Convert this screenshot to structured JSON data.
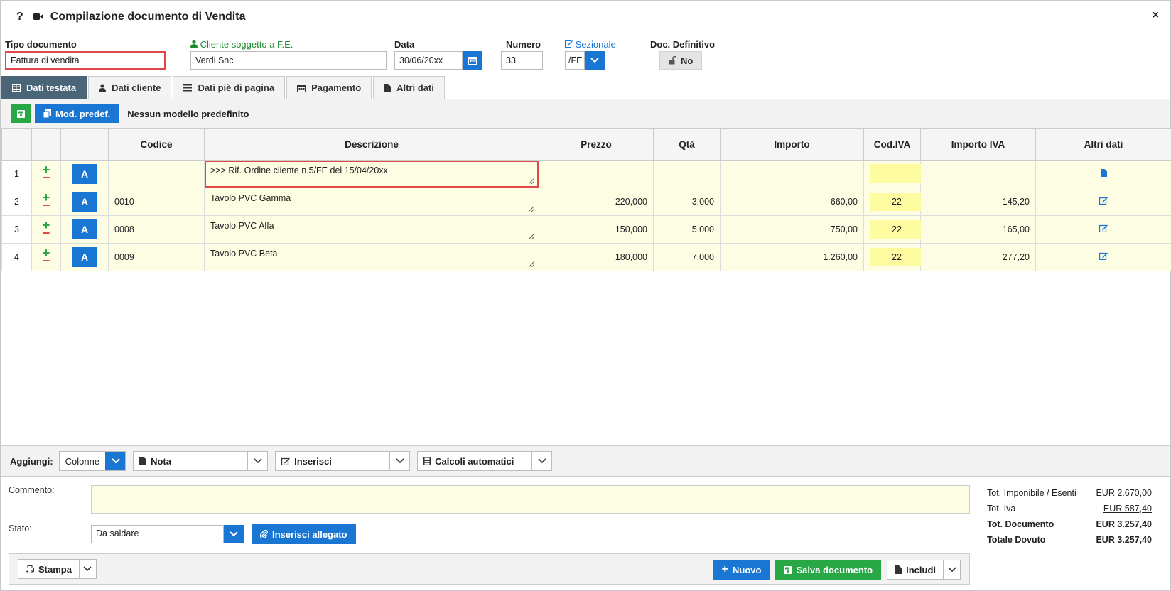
{
  "window": {
    "title": "Compilazione documento di Vendita",
    "help": "?",
    "close": "×"
  },
  "fields": {
    "tipo_documento": {
      "label": "Tipo documento",
      "value": "Fattura di vendita"
    },
    "cliente": {
      "label": "Cliente soggetto a F.E.",
      "value": "Verdi Snc"
    },
    "data": {
      "label": "Data",
      "value": "30/06/20xx"
    },
    "numero": {
      "label": "Numero",
      "value": "33"
    },
    "sezionale": {
      "label": "Sezionale",
      "value": "/FE"
    },
    "doc_definitivo": {
      "label": "Doc. Definitivo",
      "value": "No"
    }
  },
  "tabs": [
    {
      "label": "Dati testata"
    },
    {
      "label": "Dati cliente"
    },
    {
      "label": "Dati piè di pagina"
    },
    {
      "label": "Pagamento"
    },
    {
      "label": "Altri dati"
    }
  ],
  "toolbar": {
    "mod_predef": "Mod. predef.",
    "info": "Nessun modello predefinito"
  },
  "table": {
    "headers": [
      "Codice",
      "Descrizione",
      "Prezzo",
      "Qtà",
      "Importo",
      "Cod.IVA",
      "Importo IVA",
      "Altri dati"
    ],
    "action_label": "A",
    "plus": "+",
    "minus": "−",
    "rows": [
      {
        "n": "1",
        "codice": "",
        "descrizione": ">>> Rif. Ordine cliente n.5/FE del 15/04/20xx",
        "prezzo": "",
        "qta": "",
        "importo": "",
        "cod_iva": "",
        "importo_iva": ""
      },
      {
        "n": "2",
        "codice": "0010",
        "descrizione": "Tavolo PVC Gamma",
        "prezzo": "220,000",
        "qta": "3,000",
        "importo": "660,00",
        "cod_iva": "22",
        "importo_iva": "145,20"
      },
      {
        "n": "3",
        "codice": "0008",
        "descrizione": "Tavolo PVC Alfa",
        "prezzo": "150,000",
        "qta": "5,000",
        "importo": "750,00",
        "cod_iva": "22",
        "importo_iva": "165,00"
      },
      {
        "n": "4",
        "codice": "0009",
        "descrizione": "Tavolo PVC Beta",
        "prezzo": "180,000",
        "qta": "7,000",
        "importo": "1.260,00",
        "cod_iva": "22",
        "importo_iva": "277,20"
      }
    ]
  },
  "addbar": {
    "label": "Aggiungi:",
    "colonne": "Colonne",
    "nota": "Nota",
    "inserisci": "Inserisci",
    "calcoli": "Calcoli automatici"
  },
  "bottom": {
    "commento_label": "Commento:",
    "commento_value": "",
    "stato_label": "Stato:",
    "stato_value": "Da saldare",
    "allegato": "Inserisci allegato",
    "totals": [
      {
        "label": "Tot. Imponibile / Esenti",
        "value": "EUR 2.670,00"
      },
      {
        "label": "Tot. Iva",
        "value": "EUR 587,40"
      },
      {
        "label": "Tot. Documento",
        "value": "EUR 3.257,40"
      },
      {
        "label": "Totale Dovuto",
        "value": "EUR 3.257,40"
      }
    ],
    "stampa": "Stampa",
    "nuovo": "Nuovo",
    "salva": "Salva documento",
    "includi": "Includi"
  },
  "colors": {
    "primary": "#1976d2",
    "success": "#28a745",
    "danger": "#e04848",
    "active_tab": "#4a6478",
    "row_bg": "#fdfde4",
    "iva_bg": "#fffba0"
  }
}
